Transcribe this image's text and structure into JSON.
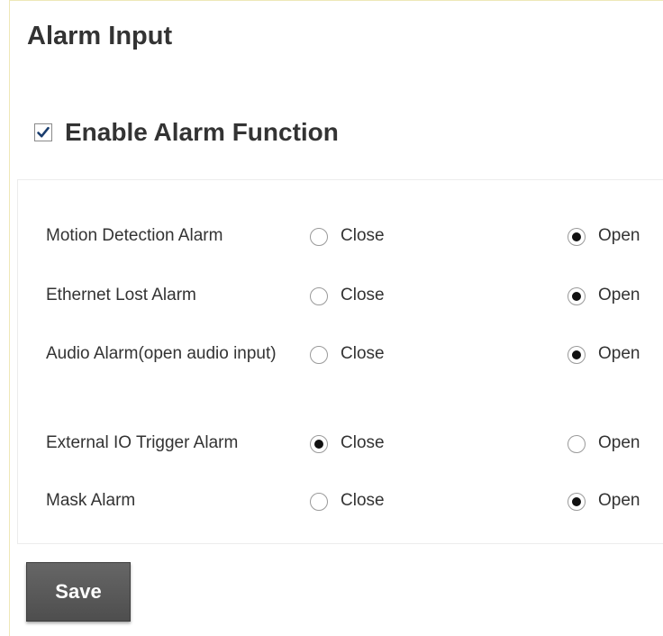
{
  "page": {
    "title": "Alarm Input"
  },
  "enable": {
    "label": "Enable Alarm Function",
    "checked": true
  },
  "alarms": [
    {
      "label": "Motion Detection Alarm",
      "close_label": "Close",
      "open_label": "Open",
      "selected": "Open"
    },
    {
      "label": "Ethernet Lost Alarm",
      "close_label": "Close",
      "open_label": "Open",
      "selected": "Open"
    },
    {
      "label": "Audio Alarm(open audio input)",
      "close_label": "Close",
      "open_label": "Open",
      "selected": "Open"
    },
    {
      "label": "External IO Trigger Alarm",
      "close_label": "Close",
      "open_label": "Open",
      "selected": "Close"
    },
    {
      "label": "Mask Alarm",
      "close_label": "Close",
      "open_label": "Open",
      "selected": "Open"
    }
  ],
  "actions": {
    "save_label": "Save"
  },
  "colors": {
    "button_background": "#5a5a5a",
    "checkbox_check": "#1a3d6e",
    "text": "#333333"
  }
}
